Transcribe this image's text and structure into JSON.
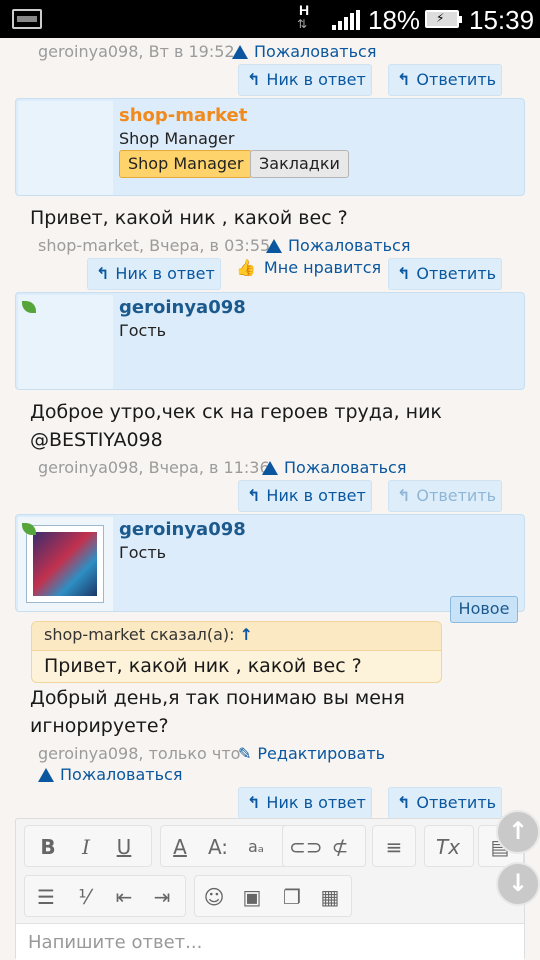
{
  "status_bar": {
    "network_letter": "H",
    "battery_percent": "18%",
    "time": "15:39"
  },
  "posts": [
    {
      "meta": "geroinya098, Вт в 19:52",
      "report": "Пожаловаться",
      "buttons": [
        "Ник в ответ",
        "Ответить"
      ]
    },
    {
      "username": "shop-market",
      "user_title": "Shop Manager",
      "badge_label": "Shop Manager",
      "bookmark_label": "Закладки",
      "message": "Привет, какой ник , какой вес ?",
      "meta": "shop-market, Вчера, в 03:55",
      "report": "Пожаловаться",
      "buttons": [
        "Ник в ответ",
        "Мне нравится",
        "Ответить"
      ]
    },
    {
      "username": "geroinya098",
      "user_title": "Гость",
      "message_line1": "Доброе утро,чек ск на героев труда, ник",
      "message_line2": "@BESTIYA098",
      "meta": "geroinya098, Вчера, в 11:36",
      "report": "Пожаловаться",
      "buttons": [
        "Ник в ответ",
        "Ответить"
      ]
    },
    {
      "username": "geroinya098",
      "user_title": "Гость",
      "new_label": "Новое",
      "quote_header": "shop-market сказал(а):",
      "quote_text": "Привет, какой ник , какой вес ?",
      "message_line1": "Добрый день,я так понимаю вы меня",
      "message_line2": "игнорируете?",
      "meta": "geroinya098, только что",
      "edit": "Редактировать",
      "report": "Пожаловаться",
      "buttons": [
        "Ник в ответ",
        "Ответить"
      ]
    }
  ],
  "editor": {
    "placeholder": "Напишите ответ..."
  },
  "colors": {
    "link": "#0a57a0",
    "username": "#1c5a8d",
    "manager": "#f08a1c",
    "box": "#dcecfa"
  }
}
